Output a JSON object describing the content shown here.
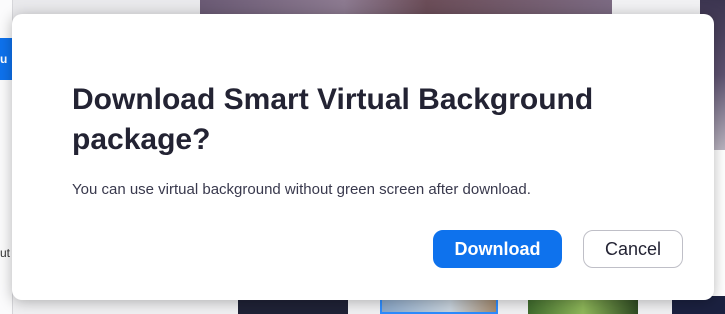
{
  "background": {
    "left_panel_fragment_top": "u",
    "left_panel_fragment_bottom": "ut"
  },
  "dialog": {
    "title": "Download Smart Virtual Background package?",
    "message": "You can use virtual background without green screen after download.",
    "primary_button": "Download",
    "secondary_button": "Cancel"
  },
  "colors": {
    "primary": "#0e72ed",
    "title_text": "#232333",
    "body_text": "#39394d"
  }
}
